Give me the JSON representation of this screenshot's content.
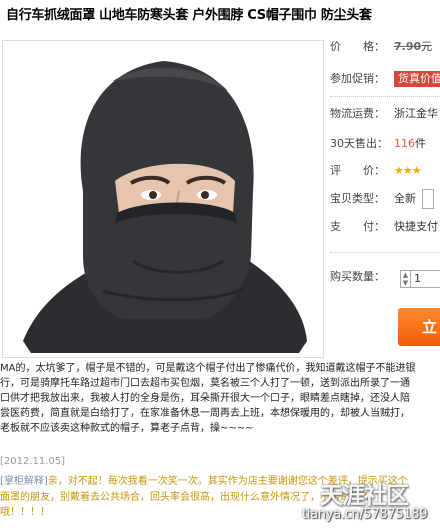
{
  "product": {
    "title": "自行车抓绒面罩 山地车防寒头套 户外围脖 CS帽子围巾 防尘头套"
  },
  "info": {
    "price_label": "价　　格：",
    "price_value": "7.90",
    "price_suffix": "元",
    "promo_label": "参加促销：",
    "promo_value": "货真价值",
    "shipping_label": "物流运费：",
    "shipping_value": "浙江金华",
    "sold_label": "30天售出：",
    "sold_value": "116",
    "sold_unit": "件",
    "rating_label": "评　　价：",
    "rating_stars": "★★★",
    "rating_value": 3,
    "type_label": "宝贝类型：",
    "type_value": "全新",
    "pay_label": "支　　付：",
    "pay_value": "快捷支付",
    "qty_label": "购买数量：",
    "qty_value": "1",
    "buy_label": "立"
  },
  "review": {
    "lines": [
      "MA的，太坑爹了，帽子是不错的，可是戴这个帽子付出了惨痛代价，我知道戴这帽子不能进银",
      "行，可是骑摩托车路过超市门口去超市买包烟，莫名被三个人打了一顿，送到派出所录了一通",
      "口供才把我放出来，我被人打的全身是伤，耳朵撕开很大一个口子，眼睛差点瞎掉，还没人陪",
      "尝医药费，简直就是白给打了，在家准备休息一周再去上班，本想保暖用的，却被人当贼打，",
      "老板就不应该卖这种款式的帽子，算老子点背，操~~~~"
    ],
    "date": "[2012.11.05]"
  },
  "reply": {
    "tag": "[掌柜解释]",
    "lines": [
      "亲，对不起！每次我看一次笑一次。其实作为店主要谢谢您这个差评，提示买这个",
      "面罩的朋友，别戴着去公共场合，回头率会很高，出现什么意外情况了，小店是不负",
      "哦！！！！"
    ]
  },
  "watermark": {
    "logo": "天涯社区",
    "url": "tianya.cn/57875189"
  },
  "colors": {
    "promo_bg": "#d4473a",
    "sold_accent": "#e9543a",
    "star": "#f3a613",
    "buy_button": "#f25c0a",
    "reply_text": "#c8930c"
  }
}
